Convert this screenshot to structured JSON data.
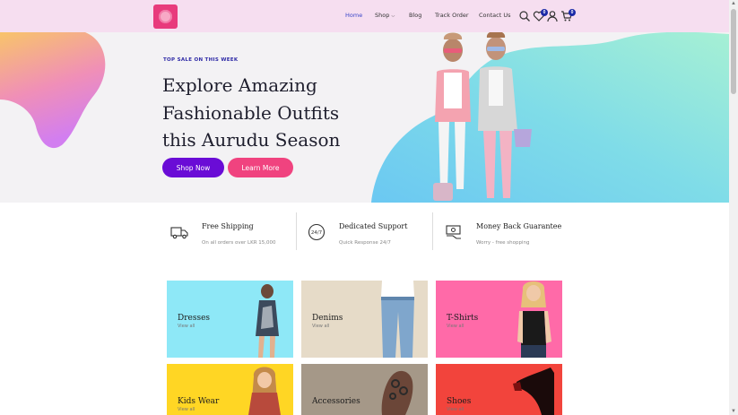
{
  "header": {
    "logo_alt": "logo",
    "nav": [
      {
        "label": "Home",
        "active": true
      },
      {
        "label": "Shop",
        "dropdown": true
      },
      {
        "label": "Blog"
      },
      {
        "label": "Track Order"
      },
      {
        "label": "Contact Us"
      }
    ],
    "wishlist_count": "0",
    "cart_count": "0"
  },
  "hero": {
    "kicker": "TOP SALE ON THIS WEEK",
    "title_lines": [
      "Explore Amazing",
      "Fashionable Outfits",
      "this Aurudu Season"
    ],
    "shop_now_label": "Shop Now",
    "learn_more_label": "Learn More"
  },
  "features": [
    {
      "title": "Free Shipping",
      "subtitle": "On all orders over LKR 15,000",
      "icon": "truck-icon"
    },
    {
      "title": "Dedicated Support",
      "subtitle": "Quick Response 24/7",
      "icon": "support-24-7-icon"
    },
    {
      "title": "Money Back Guarantee",
      "subtitle": "Worry - free shopping",
      "icon": "money-back-icon"
    }
  ],
  "categories": [
    {
      "name": "Dresses",
      "link": "View all",
      "color": "#8ee8f7"
    },
    {
      "name": "Denims",
      "link": "View all",
      "color": "#e6dbc8"
    },
    {
      "name": "T-Shirts",
      "link": "View all",
      "color": "#ff6aa8"
    },
    {
      "name": "Kids Wear",
      "link": "View all",
      "color": "#ffd624"
    },
    {
      "name": "Accessories",
      "link": "",
      "color": "#a59888"
    },
    {
      "name": "Shoes",
      "link": "View all",
      "color": "#f2443c"
    }
  ],
  "colors": {
    "header_bg": "#f6def0",
    "primary_button": "#6a0cd6",
    "secondary_button": "#f0437f",
    "nav_active": "#3b47c9"
  }
}
